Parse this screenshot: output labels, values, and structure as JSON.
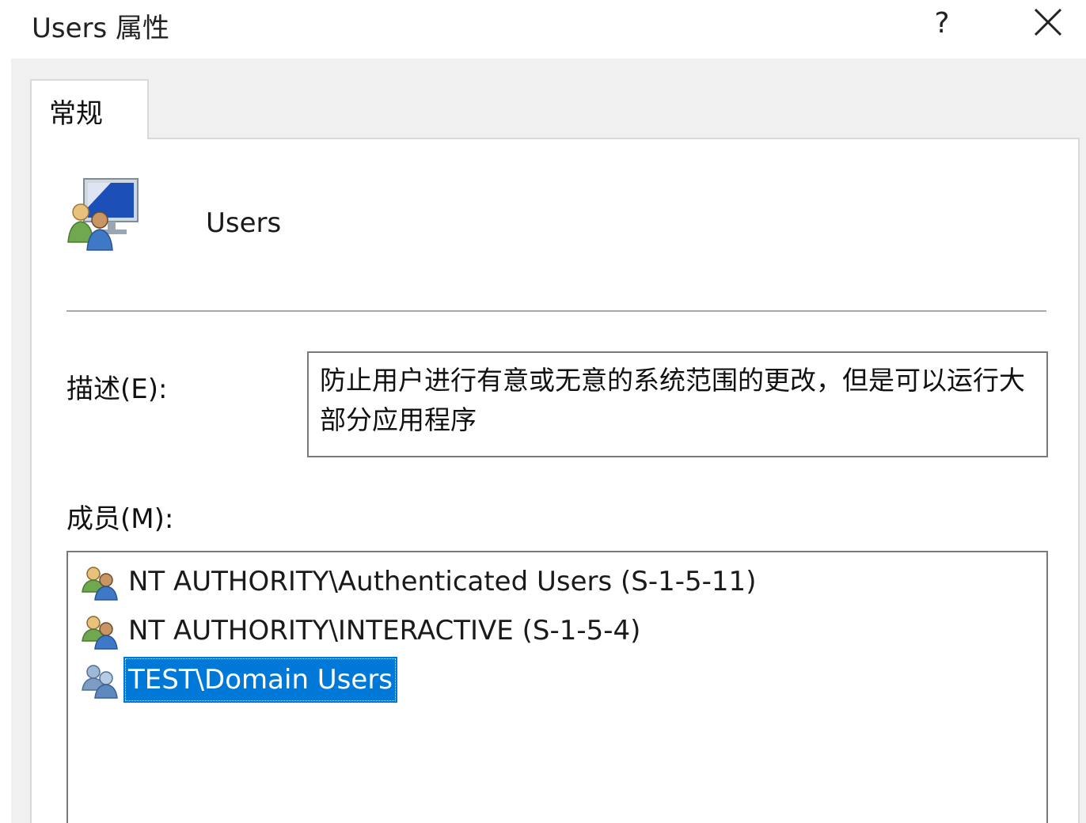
{
  "window": {
    "title": "Users 属性",
    "help_label": "?",
    "close_icon": "close-icon"
  },
  "tabs": [
    {
      "label": "常规",
      "active": true
    }
  ],
  "general": {
    "group_icon": "user-group-monitor-icon",
    "group_name": "Users",
    "description_label": "描述(E):",
    "description_value": "防止用户进行有意或无意的系统范围的更改，但是可以运行大部分应用程序",
    "members_label": "成员(M):",
    "members": [
      {
        "name": "NT AUTHORITY\\Authenticated Users (S-1-5-11)",
        "icon": "well-known-group-icon",
        "selected": false
      },
      {
        "name": "NT AUTHORITY\\INTERACTIVE (S-1-5-4)",
        "icon": "well-known-group-icon",
        "selected": false
      },
      {
        "name": "TEST\\Domain Users",
        "icon": "domain-group-icon",
        "selected": true
      }
    ]
  },
  "colors": {
    "selection": "#0078d7",
    "dialog_bg": "#f0f0f0",
    "panel_bg": "#ffffff"
  }
}
